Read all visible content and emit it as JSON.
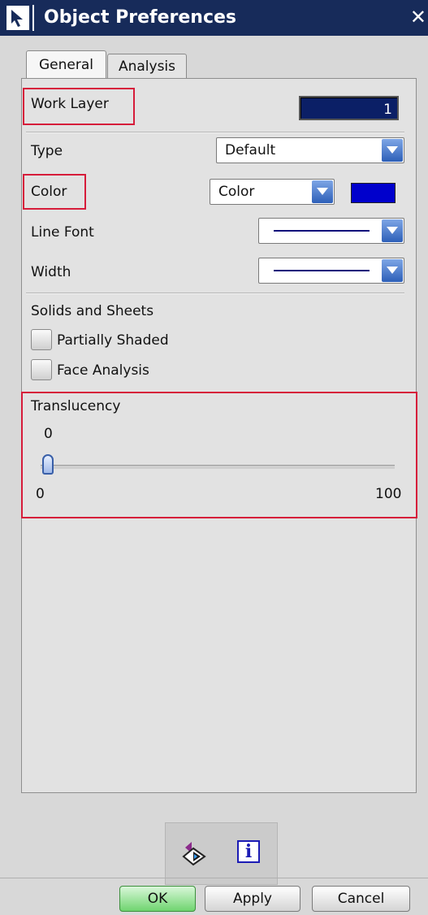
{
  "window": {
    "title": "Object Preferences",
    "close_glyph": "✕"
  },
  "tabs": [
    {
      "label": "General",
      "active": true
    },
    {
      "label": "Analysis",
      "active": false
    }
  ],
  "work_layer": {
    "label": "Work Layer",
    "value": "1"
  },
  "type": {
    "label": "Type",
    "selected": "Default"
  },
  "color": {
    "label": "Color",
    "selected": "Color",
    "swatch_color": "#0000cc"
  },
  "line_font": {
    "label": "Line Font",
    "sample": "solid"
  },
  "width": {
    "label": "Width",
    "sample": "solid"
  },
  "solids": {
    "header": "Solids and Sheets",
    "partially_shaded": {
      "label": "Partially Shaded",
      "checked": false
    },
    "face_analysis": {
      "label": "Face Analysis",
      "checked": false
    }
  },
  "translucency": {
    "label": "Translucency",
    "value": "0",
    "min_label": "0",
    "max_label": "100",
    "level_percent": 0
  },
  "toolbox": {
    "icons": [
      "inherit-settings-icon",
      "info-icon"
    ],
    "info_glyph": "i"
  },
  "buttons": {
    "ok": "OK",
    "apply": "Apply",
    "cancel": "Cancel"
  },
  "colors": {
    "titlebar": "#172b5a",
    "highlight": "#d61c3a",
    "selected_field": "#0b1f66",
    "ok_button": "#6fd46f"
  }
}
